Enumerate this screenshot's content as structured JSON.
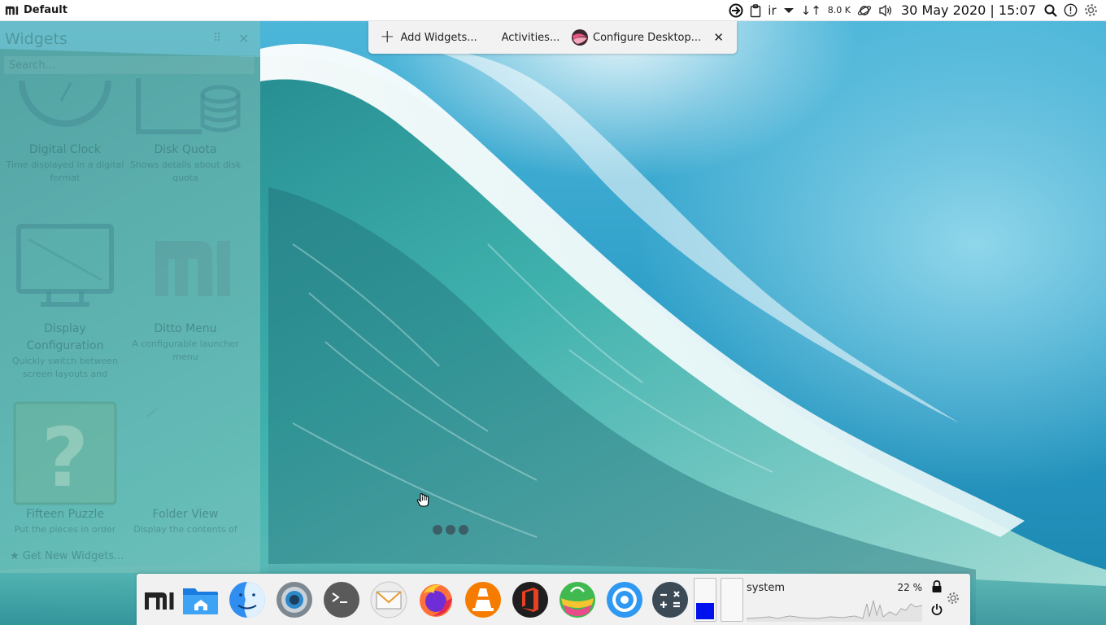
{
  "top_panel": {
    "title": "Default",
    "keyboard_layout": "ir",
    "network_speed": "8.0 K",
    "datetime": "30 May 2020 | 15:07"
  },
  "toolbox": {
    "add_widgets": "Add Widgets...",
    "activities": "Activities...",
    "configure_desktop": "Configure Desktop..."
  },
  "widgets_explorer": {
    "title": "Widgets",
    "search_placeholder": "Search...",
    "widgets": [
      {
        "name": "Digital Clock",
        "description": "Time displayed in a digital format"
      },
      {
        "name": "Disk Quota",
        "description": "Shows details about disk quota"
      },
      {
        "name": "Display Configuration",
        "description": "Quickly switch between screen layouts and"
      },
      {
        "name": "Ditto Menu",
        "description": "A configurable launcher menu"
      },
      {
        "name": "Fifteen Puzzle",
        "description": "Put the pieces in order"
      },
      {
        "name": "Folder View",
        "description": "Display the contents of"
      }
    ],
    "get_new": "Get New Widgets..."
  },
  "dock": {
    "apps": [
      {
        "name": "Mi Launcher",
        "icon": "mi-logo-icon"
      },
      {
        "name": "Files",
        "icon": "folder-home-icon"
      },
      {
        "name": "Finder",
        "icon": "finder-icon"
      },
      {
        "name": "Settings",
        "icon": "settings-icon"
      },
      {
        "name": "Terminal",
        "icon": "terminal-icon"
      },
      {
        "name": "Mail",
        "icon": "mail-icon"
      },
      {
        "name": "Firefox",
        "icon": "firefox-icon"
      },
      {
        "name": "VLC",
        "icon": "vlc-icon"
      },
      {
        "name": "Office",
        "icon": "office-icon"
      },
      {
        "name": "Store",
        "icon": "store-icon"
      },
      {
        "name": "Browser",
        "icon": "safari-icon"
      },
      {
        "name": "Calculator",
        "icon": "calculator-icon"
      }
    ],
    "meter_1_level": 0.42,
    "meter_2_level": 0.0,
    "system_monitor": {
      "label": "system",
      "percent": "22 %"
    }
  },
  "colors": {
    "panel_bg": "#ffffff",
    "dock_bg": "#f1f1f1",
    "meter_fill": "#0011ee",
    "widgets_overlay": "#82c3be"
  }
}
